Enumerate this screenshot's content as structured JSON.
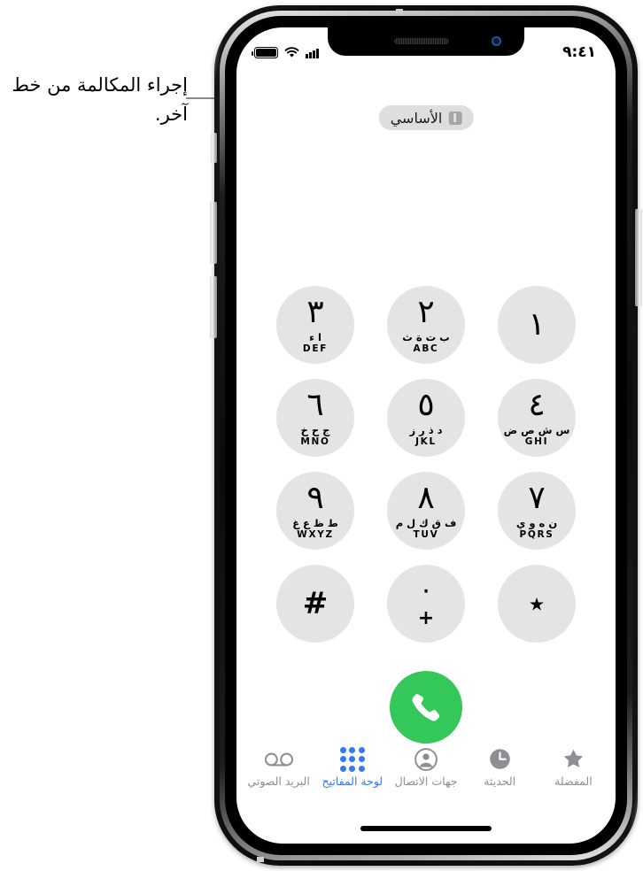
{
  "callout": {
    "text": "إجراء المكالمة من خط آخر."
  },
  "status_bar": {
    "time": "٩:٤١",
    "battery_icon": "battery-icon",
    "wifi_icon": "wifi-icon",
    "signal_icon": "cellular-signal-icon"
  },
  "line_selector": {
    "label": "الأساسي",
    "icon": "sim-card-icon"
  },
  "keypad": {
    "keys": [
      {
        "digit": "١",
        "arabic_letters": "",
        "latin_letters": ""
      },
      {
        "digit": "٢",
        "arabic_letters": "ب ت ة ث",
        "latin_letters": "ABC"
      },
      {
        "digit": "٣",
        "arabic_letters": "ا ء",
        "latin_letters": "DEF"
      },
      {
        "digit": "٤",
        "arabic_letters": "س ش ص ض",
        "latin_letters": "GHI"
      },
      {
        "digit": "٥",
        "arabic_letters": "د ذ ر ز",
        "latin_letters": "JKL"
      },
      {
        "digit": "٦",
        "arabic_letters": "ج ح خ",
        "latin_letters": "MNO"
      },
      {
        "digit": "٧",
        "arabic_letters": "ن ه و ي",
        "latin_letters": "PQRS"
      },
      {
        "digit": "٨",
        "arabic_letters": "ف ق ك ل م",
        "latin_letters": "TUV"
      },
      {
        "digit": "٩",
        "arabic_letters": "ط ظ ع غ",
        "latin_letters": "WXYZ"
      },
      {
        "digit": "٭",
        "arabic_letters": "",
        "latin_letters": ""
      },
      {
        "digit": "٠",
        "arabic_letters": "",
        "latin_letters": "",
        "alt": "+"
      },
      {
        "digit": "#",
        "arabic_letters": "",
        "latin_letters": ""
      }
    ]
  },
  "call_button": {
    "icon": "phone-handset-icon",
    "color": "#34c759"
  },
  "tab_bar": {
    "active_color": "#3478f6",
    "inactive_color": "#8e8e93",
    "tabs": [
      {
        "label": "المفضلة",
        "icon": "star-icon",
        "active": false
      },
      {
        "label": "الحديثة",
        "icon": "clock-icon",
        "active": false
      },
      {
        "label": "جهات الاتصال",
        "icon": "contacts-person-icon",
        "active": false
      },
      {
        "label": "لوحة المفاتيح",
        "icon": "keypad-dots-icon",
        "active": true
      },
      {
        "label": "البريد الصوتي",
        "icon": "voicemail-icon",
        "active": false
      }
    ]
  }
}
